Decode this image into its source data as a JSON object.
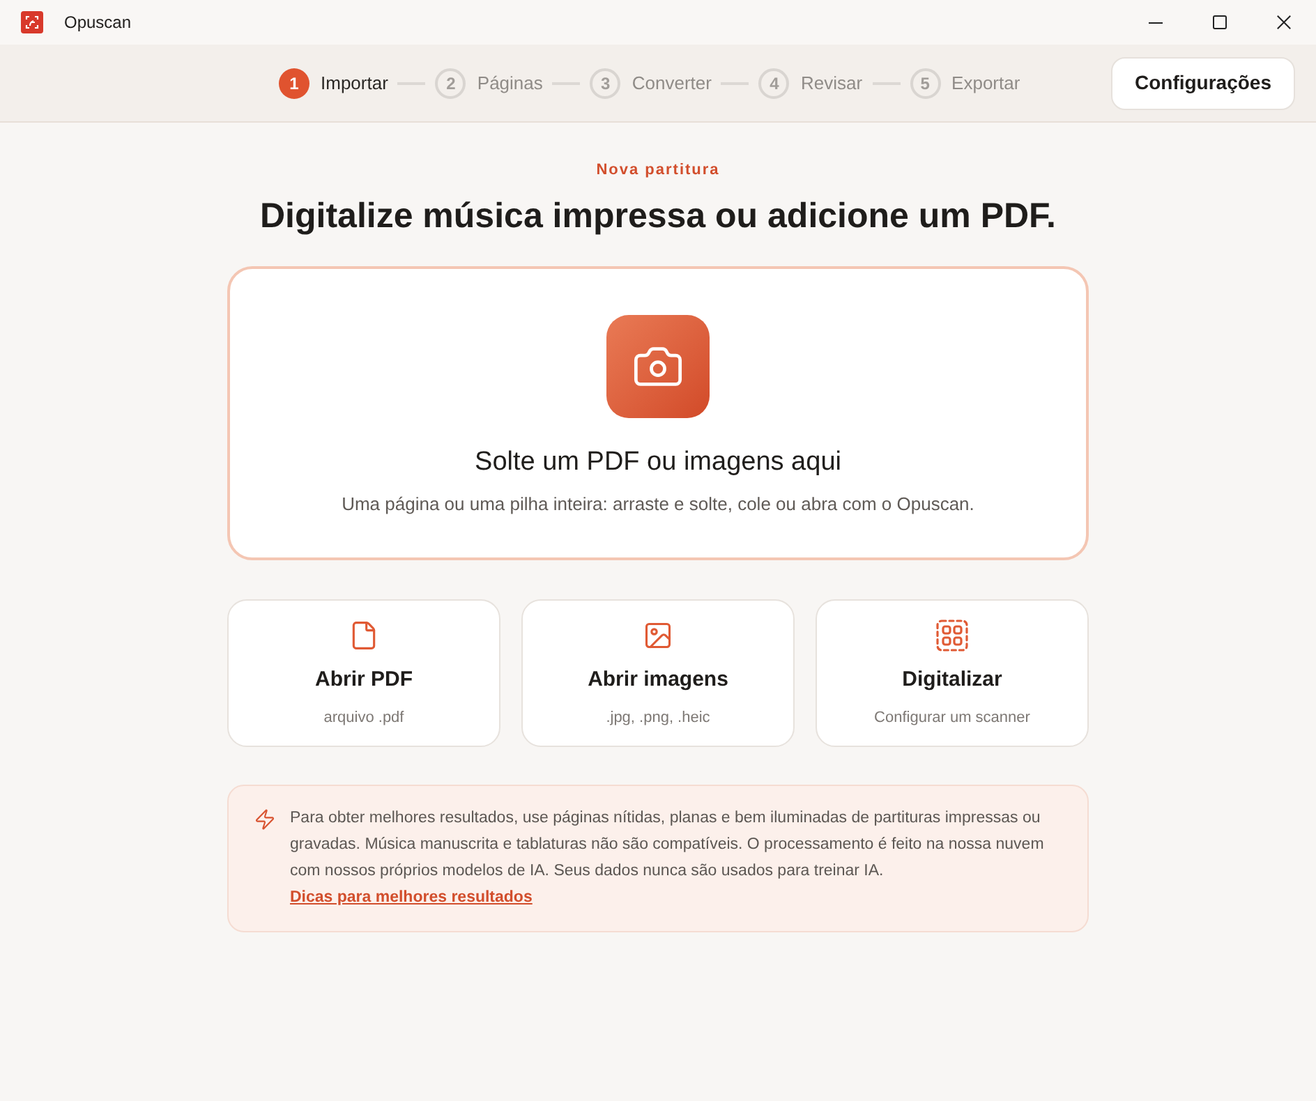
{
  "window": {
    "title": "Opuscan"
  },
  "steps": [
    {
      "number": "1",
      "label": "Importar",
      "selected": true
    },
    {
      "number": "2",
      "label": "Páginas",
      "selected": false
    },
    {
      "number": "3",
      "label": "Converter",
      "selected": false
    },
    {
      "number": "4",
      "label": "Revisar",
      "selected": false
    },
    {
      "number": "5",
      "label": "Exportar",
      "selected": false
    }
  ],
  "settings_button": "Configurações",
  "eyebrow": "Nova partitura",
  "heading": "Digitalize música impressa ou adicione um PDF.",
  "drop_zone": {
    "title": "Solte um PDF ou imagens aqui",
    "subtitle": "Uma página ou uma pilha inteira: arraste e solte, cole ou abra com o Opuscan."
  },
  "actions": [
    {
      "kind": "pdf",
      "title": "Abrir PDF",
      "subtitle": "arquivo .pdf"
    },
    {
      "kind": "images",
      "title": "Abrir imagens",
      "subtitle": ".jpg, .png, .heic"
    },
    {
      "kind": "scan",
      "title": "Digitalizar",
      "subtitle": "Configurar um scanner"
    }
  ],
  "notice": {
    "text": "Para obter melhores resultados, use páginas nítidas, planas e bem iluminadas de partituras impressas ou gravadas. Música manuscrita e tablaturas não são compatíveis. O processamento é feito na nossa nuvem com nossos próprios modelos de IA. Seus dados nunca são usados para treinar IA.",
    "link": "Dicas para melhores resultados"
  }
}
